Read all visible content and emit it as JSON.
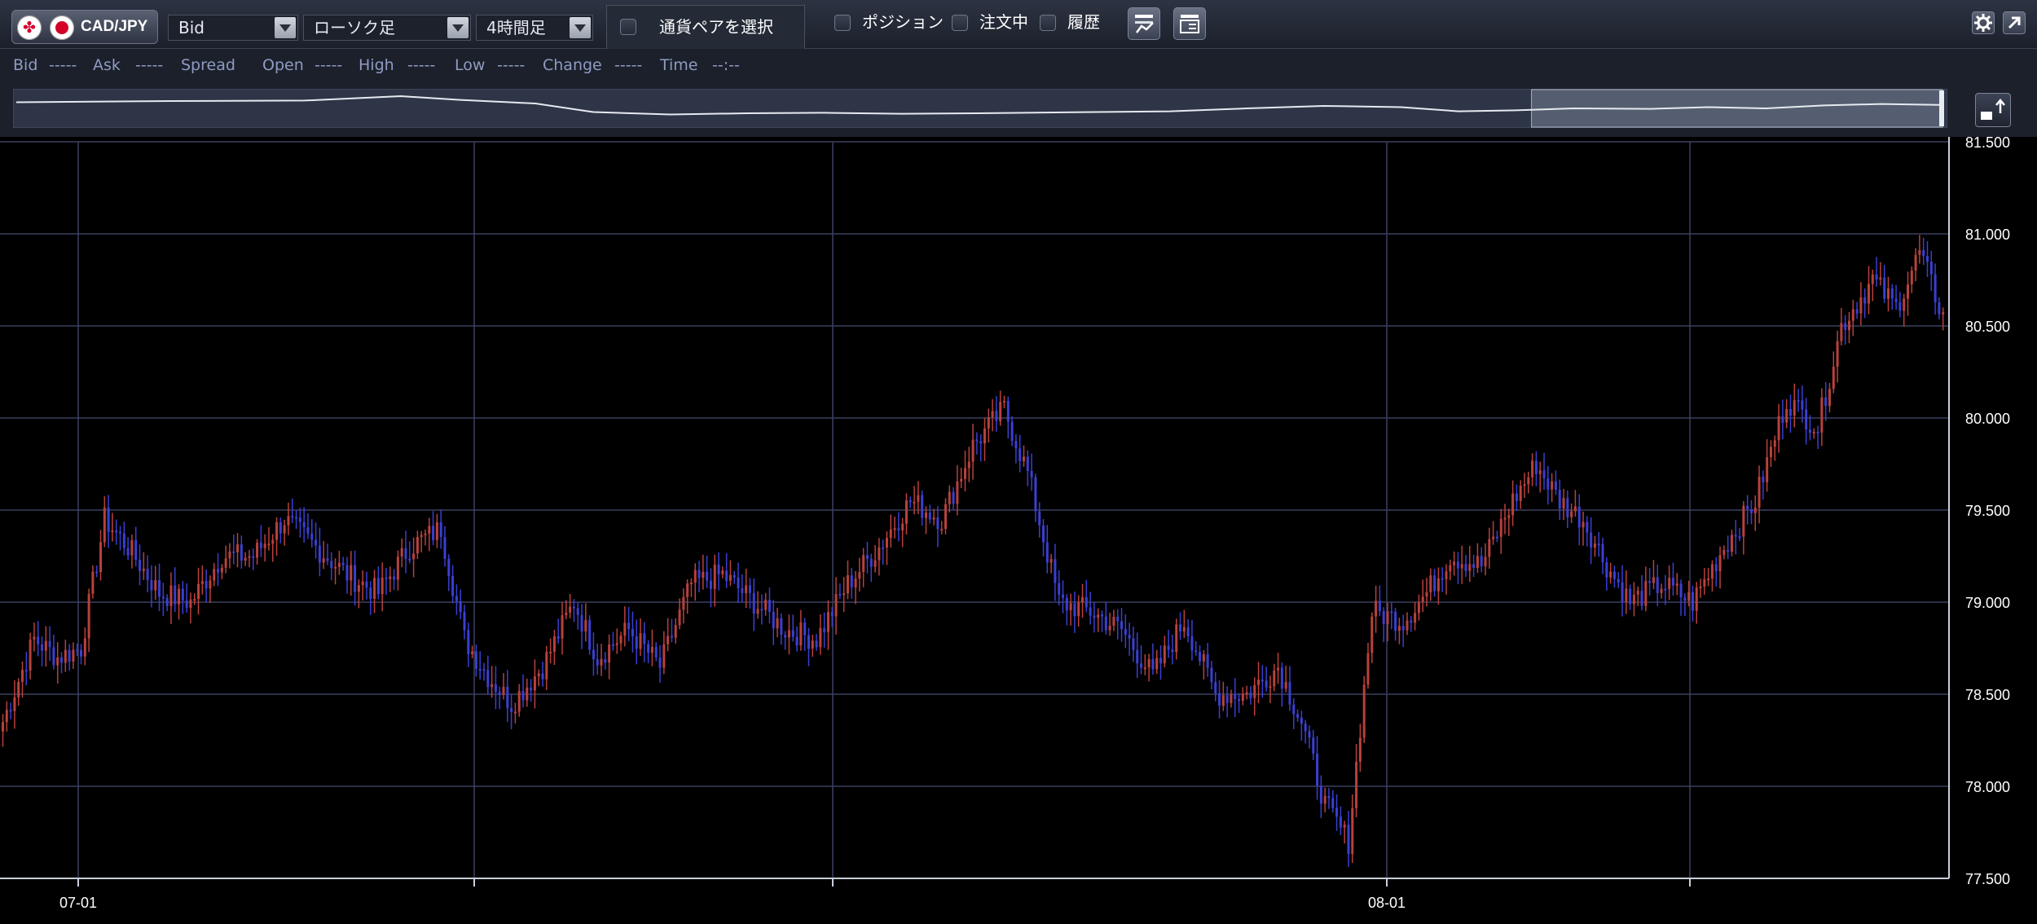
{
  "toolbar": {
    "pair": "CAD/JPY",
    "price_type": "Bid",
    "chart_type": "ローソク足",
    "timeframe": "4時間足",
    "pair_selector": "通貨ペアを選択",
    "checks": {
      "position": "ポジション",
      "orders": "注文中",
      "history": "履歴"
    },
    "icons": [
      "chart-settings-icon",
      "layout-icon",
      "gear-icon",
      "popout-icon"
    ]
  },
  "info": {
    "bid_label": "Bid",
    "bid_value": "-----",
    "ask_label": "Ask",
    "ask_value": "-----",
    "spread_label": "Spread",
    "open_label": "Open",
    "open_value": "-----",
    "high_label": "High",
    "high_value": "-----",
    "low_label": "Low",
    "low_value": "-----",
    "change_label": "Change",
    "change_value": "-----",
    "time_label": "Time",
    "time_value": "--:--"
  },
  "colors": {
    "up": "#b8413c",
    "down": "#3a3fd0",
    "grid": "#3a4160",
    "axis_text": "#ffffff"
  },
  "chart_data": {
    "type": "candlestick",
    "ylim": [
      77.5,
      81.5
    ],
    "yticks": [
      "81.500",
      "81.000",
      "80.500",
      "80.000",
      "79.500",
      "79.000",
      "78.500",
      "78.000",
      "77.500"
    ],
    "xticks": [
      "07-01",
      "08-01"
    ],
    "anchors": [
      [
        0,
        78.35
      ],
      [
        8,
        78.8
      ],
      [
        14,
        78.7
      ],
      [
        20,
        78.75
      ],
      [
        26,
        79.45
      ],
      [
        32,
        79.3
      ],
      [
        40,
        79.05
      ],
      [
        48,
        79.0
      ],
      [
        56,
        79.25
      ],
      [
        64,
        79.25
      ],
      [
        72,
        79.45
      ],
      [
        80,
        79.3
      ],
      [
        88,
        79.15
      ],
      [
        96,
        79.05
      ],
      [
        104,
        79.3
      ],
      [
        112,
        79.4
      ],
      [
        118,
        78.8
      ],
      [
        124,
        78.6
      ],
      [
        130,
        78.45
      ],
      [
        138,
        78.65
      ],
      [
        146,
        79.0
      ],
      [
        152,
        78.7
      ],
      [
        160,
        78.85
      ],
      [
        168,
        78.65
      ],
      [
        176,
        79.1
      ],
      [
        184,
        79.15
      ],
      [
        192,
        79.0
      ],
      [
        200,
        78.85
      ],
      [
        208,
        78.8
      ],
      [
        216,
        79.1
      ],
      [
        224,
        79.3
      ],
      [
        232,
        79.55
      ],
      [
        240,
        79.45
      ],
      [
        248,
        79.85
      ],
      [
        256,
        80.05
      ],
      [
        262,
        79.7
      ],
      [
        270,
        79.0
      ],
      [
        278,
        78.95
      ],
      [
        286,
        78.85
      ],
      [
        294,
        78.6
      ],
      [
        302,
        78.9
      ],
      [
        310,
        78.5
      ],
      [
        318,
        78.5
      ],
      [
        326,
        78.65
      ],
      [
        332,
        78.35
      ],
      [
        338,
        77.9
      ],
      [
        344,
        77.7
      ],
      [
        350,
        78.95
      ],
      [
        358,
        78.9
      ],
      [
        364,
        79.05
      ],
      [
        370,
        79.25
      ],
      [
        378,
        79.2
      ],
      [
        386,
        79.55
      ],
      [
        392,
        79.75
      ],
      [
        398,
        79.55
      ],
      [
        404,
        79.45
      ],
      [
        410,
        79.2
      ],
      [
        416,
        79.0
      ],
      [
        424,
        79.1
      ],
      [
        432,
        79.0
      ],
      [
        440,
        79.3
      ],
      [
        448,
        79.55
      ],
      [
        456,
        80.1
      ],
      [
        464,
        79.95
      ],
      [
        470,
        80.5
      ],
      [
        478,
        80.75
      ],
      [
        484,
        80.6
      ],
      [
        490,
        80.9
      ],
      [
        496,
        80.55
      ]
    ],
    "overview_line": [
      [
        0,
        0.35
      ],
      [
        0.08,
        0.3
      ],
      [
        0.15,
        0.28
      ],
      [
        0.2,
        0.1
      ],
      [
        0.23,
        0.25
      ],
      [
        0.27,
        0.4
      ],
      [
        0.3,
        0.75
      ],
      [
        0.34,
        0.85
      ],
      [
        0.38,
        0.8
      ],
      [
        0.42,
        0.78
      ],
      [
        0.46,
        0.82
      ],
      [
        0.5,
        0.8
      ],
      [
        0.55,
        0.76
      ],
      [
        0.6,
        0.72
      ],
      [
        0.64,
        0.6
      ],
      [
        0.68,
        0.5
      ],
      [
        0.72,
        0.55
      ],
      [
        0.75,
        0.72
      ],
      [
        0.78,
        0.68
      ],
      [
        0.81,
        0.6
      ],
      [
        0.85,
        0.62
      ],
      [
        0.88,
        0.55
      ],
      [
        0.91,
        0.6
      ],
      [
        0.94,
        0.48
      ],
      [
        0.97,
        0.42
      ],
      [
        1.0,
        0.46
      ]
    ],
    "overview_window": [
      0.785,
      1.0
    ]
  }
}
